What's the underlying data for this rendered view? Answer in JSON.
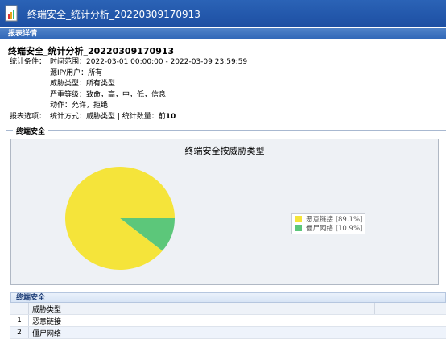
{
  "window": {
    "title": "终端安全_统计分析_20220309170913"
  },
  "panel": {
    "header": "报表详情"
  },
  "report": {
    "title": "终端安全_统计分析_20220309170913",
    "conditions_label": "统计条件：",
    "time_label": "时间范围：",
    "time_value": "2022-03-01 00:00:00 - 2022-03-09 23:59:59",
    "source_label": "源IP/用户：",
    "source_value": "所有",
    "threat_label": "威胁类型：",
    "threat_value": "所有类型",
    "severity_label": "严重等级：",
    "severity_value": "致命，高，中，低，信息",
    "action_label": "动作：",
    "action_value": "允许，拒绝",
    "options_label": "报表选项：",
    "options_value": "统计方式：威胁类型 | 统计数量：前",
    "options_count": "10"
  },
  "section": {
    "label": "终端安全"
  },
  "chart_data": {
    "type": "pie",
    "title": "终端安全按威胁类型",
    "labels": [
      "恶意链接",
      "僵尸网络"
    ],
    "values": [
      89.1,
      10.9
    ],
    "legend_text": [
      "恶意链接 [89.1%]",
      "僵尸网络 [10.9%]"
    ],
    "colors": [
      "#f5e43a",
      "#5cc77a"
    ],
    "legend": "right"
  },
  "table": {
    "section_label": "终端安全",
    "column": "威胁类型",
    "rows": [
      {
        "index": "1",
        "name": "恶意链接"
      },
      {
        "index": "2",
        "name": "僵尸网络"
      }
    ]
  }
}
